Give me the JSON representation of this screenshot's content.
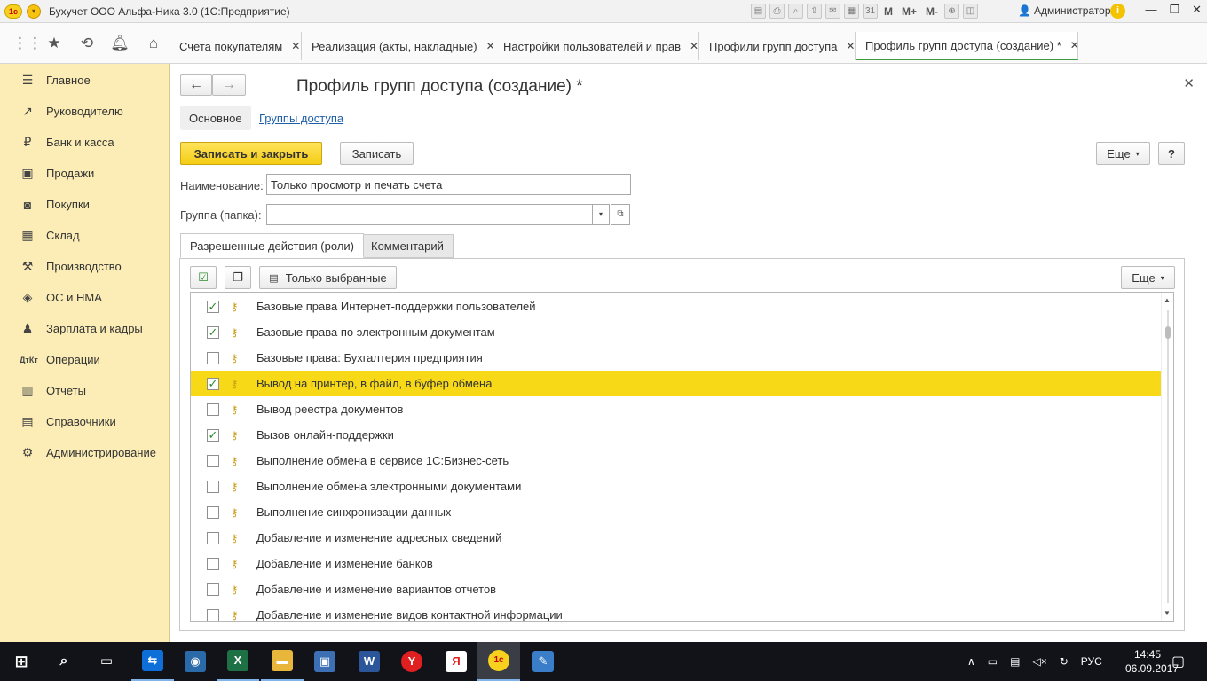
{
  "window": {
    "title": "Бухучет ООО  Альфа-Ника 3.0  (1С:Предприятие)",
    "user": "Администратор",
    "toolbar_labels": [
      "M",
      "M+",
      "M-"
    ]
  },
  "tabs": [
    {
      "label": "Счета покупателям"
    },
    {
      "label": "Реализация (акты, накладные)"
    },
    {
      "label": "Настройки пользователей и прав"
    },
    {
      "label": "Профили групп доступа"
    },
    {
      "label": "Профиль групп доступа (создание) *"
    }
  ],
  "sidebar": {
    "items": [
      {
        "label": "Главное",
        "icon": "menu-icon"
      },
      {
        "label": "Руководителю",
        "icon": "trend-icon"
      },
      {
        "label": "Банк и касса",
        "icon": "ruble-icon"
      },
      {
        "label": "Продажи",
        "icon": "cart-icon"
      },
      {
        "label": "Покупки",
        "icon": "basket-icon"
      },
      {
        "label": "Склад",
        "icon": "warehouse-icon"
      },
      {
        "label": "Производство",
        "icon": "factory-icon"
      },
      {
        "label": "ОС и НМА",
        "icon": "assets-icon"
      },
      {
        "label": "Зарплата и кадры",
        "icon": "person-icon"
      },
      {
        "label": "Операции",
        "icon": "dt-kt-icon"
      },
      {
        "label": "Отчеты",
        "icon": "bar-chart-icon"
      },
      {
        "label": "Справочники",
        "icon": "book-icon"
      },
      {
        "label": "Администрирование",
        "icon": "gear-icon"
      }
    ]
  },
  "form": {
    "title": "Профиль групп доступа (создание) *",
    "section_main": "Основное",
    "section_link": "Группы доступа",
    "save_close_label": "Записать и закрыть",
    "save_label": "Записать",
    "more_label": "Еще",
    "help_label": "?",
    "name_label": "Наименование:",
    "name_value": "Только просмотр и печать счета",
    "group_label": "Группа (папка):",
    "group_value": "",
    "tab_roles": "Разрешенные действия (роли)",
    "tab_comment": "Комментарий",
    "only_selected_label": "Только выбранные",
    "grid_more_label": "Еще"
  },
  "roles": [
    {
      "label": "Базовые права Интернет-поддержки пользователей",
      "checked": true,
      "selected": false
    },
    {
      "label": "Базовые права по электронным документам",
      "checked": true,
      "selected": false
    },
    {
      "label": "Базовые права: Бухгалтерия предприятия",
      "checked": false,
      "selected": false
    },
    {
      "label": "Вывод на принтер, в файл, в буфер обмена",
      "checked": true,
      "selected": true
    },
    {
      "label": "Вывод реестра документов",
      "checked": false,
      "selected": false
    },
    {
      "label": "Вызов онлайн-поддержки",
      "checked": true,
      "selected": false
    },
    {
      "label": "Выполнение обмена в сервисе 1С:Бизнес-сеть",
      "checked": false,
      "selected": false
    },
    {
      "label": "Выполнение обмена электронными документами",
      "checked": false,
      "selected": false
    },
    {
      "label": "Выполнение синхронизации данных",
      "checked": false,
      "selected": false
    },
    {
      "label": "Добавление и изменение адресных сведений",
      "checked": false,
      "selected": false
    },
    {
      "label": "Добавление и изменение банков",
      "checked": false,
      "selected": false
    },
    {
      "label": "Добавление и изменение вариантов отчетов",
      "checked": false,
      "selected": false
    },
    {
      "label": "Добавление и изменение видов контактной информации",
      "checked": false,
      "selected": false
    }
  ],
  "taskbar": {
    "language": "РУС",
    "time": "14:45",
    "date": "06.09.2017"
  }
}
